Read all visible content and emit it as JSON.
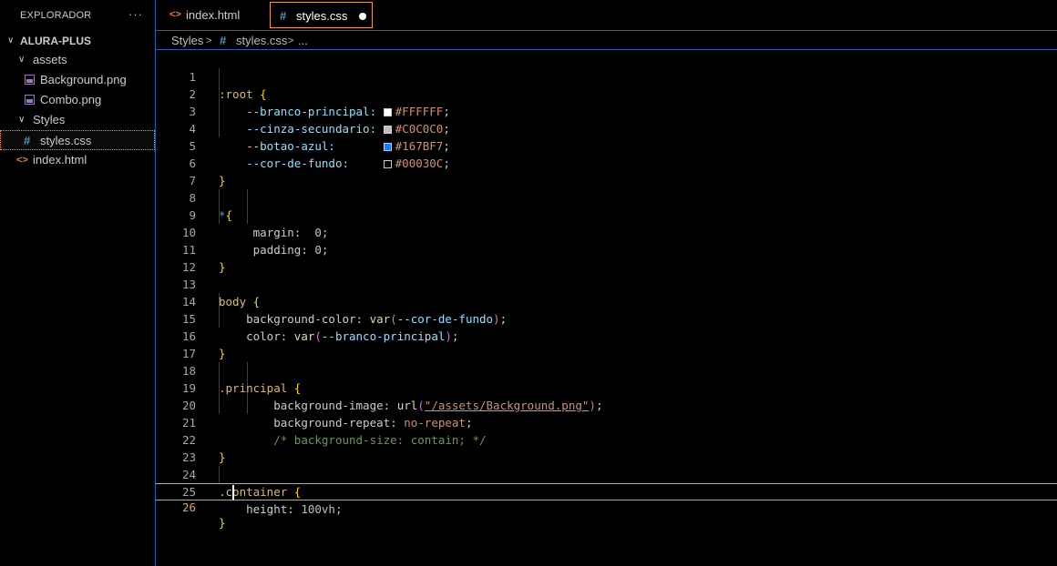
{
  "sidebar": {
    "title": "EXPLORADOR",
    "more": "···",
    "project": "ALURA-PLUS",
    "items": [
      {
        "label": "assets"
      },
      {
        "label": "Background.png"
      },
      {
        "label": "Combo.png"
      },
      {
        "label": "Styles"
      },
      {
        "label": "styles.css"
      },
      {
        "label": "index.html"
      }
    ]
  },
  "tabs": [
    {
      "label": "index.html",
      "icon": "html-icon"
    },
    {
      "label": "styles.css",
      "icon": "css-hash-icon",
      "modified": true
    }
  ],
  "breadcrumb": {
    "folder": "Styles",
    "file": "styles.css",
    "more": "..."
  },
  "colors": {
    "accent": "#e6a04b",
    "border": "#2b5fa6",
    "branco_principal": "#FFFFFF",
    "cinza_secundario": "#C0C0C0",
    "botao_azul": "#167BF7",
    "cor_de_fundo": "#00030C"
  },
  "editor": {
    "current_line": 26,
    "lines": [
      {
        "n": "1"
      },
      {
        "n": "2"
      },
      {
        "n": "3"
      },
      {
        "n": "4"
      },
      {
        "n": "5"
      },
      {
        "n": "6"
      },
      {
        "n": "7"
      },
      {
        "n": "8"
      },
      {
        "n": "9"
      },
      {
        "n": "10"
      },
      {
        "n": "11"
      },
      {
        "n": "12"
      },
      {
        "n": "13"
      },
      {
        "n": "14"
      },
      {
        "n": "15"
      },
      {
        "n": "16"
      },
      {
        "n": "17"
      },
      {
        "n": "18"
      },
      {
        "n": "19"
      },
      {
        "n": "20"
      },
      {
        "n": "21"
      },
      {
        "n": "22"
      },
      {
        "n": "23"
      },
      {
        "n": "24"
      },
      {
        "n": "25"
      },
      {
        "n": "26"
      }
    ],
    "code": {
      "l1_sel": ":root",
      "l2_prop": "--branco-principal:",
      "l2_val": "#FFFFFF",
      "l3_prop": "--cinza-secundario:",
      "l3_val": "#C0C0C0",
      "l4_prop": "--botao-azul:",
      "l4_val": "#167BF7",
      "l5_prop": "--cor-de-fundo:",
      "l5_val": "#00030C",
      "l8_sel": "*",
      "l9_prop": "margin:",
      "l9_val": "0",
      "l10_prop": "padding:",
      "l10_val": "0",
      "l13_sel": "body",
      "l14_prop": "background-color:",
      "l14_fn": "var",
      "l14_arg": "--cor-de-fundo",
      "l15_prop": "color:",
      "l15_fn": "var",
      "l15_arg": "--branco-principal",
      "l18_sel": ".principal",
      "l19_prop": "background-image:",
      "l19_fn": "url",
      "l19_str": "\"/assets/Background.png\"",
      "l20_prop": "background-repeat:",
      "l20_val": "no-repeat",
      "l21_cmt": "/* background-size: contain; */",
      "l24_sel": ".container",
      "l25_prop": "height:",
      "l25_val": "100vh"
    }
  }
}
